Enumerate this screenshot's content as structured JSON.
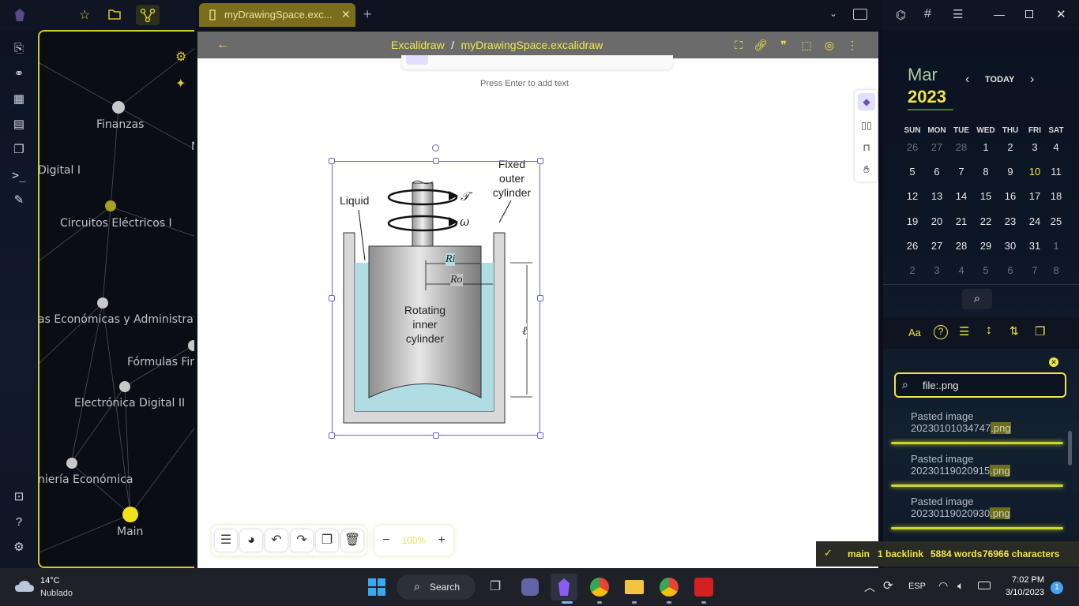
{
  "window": {
    "tab_title": "myDrawingSpace.exc...",
    "add_tab": "+"
  },
  "doc_header": {
    "back": "←",
    "breadcrumb_root": "Excalidraw",
    "separator": "/",
    "file_name": "myDrawingSpace.excalidraw"
  },
  "graph": {
    "nodes": [
      {
        "label": "Finanzas"
      },
      {
        "label": "Digital I"
      },
      {
        "label": "Circuitos Eléctricos I"
      },
      {
        "label": "as Económicas y Administrativa"
      },
      {
        "label": "Fórmulas Fina"
      },
      {
        "label": "Electrónica Digital II"
      },
      {
        "label": "niería Económica"
      },
      {
        "label": "Main"
      },
      {
        "label": "N"
      }
    ]
  },
  "canvas": {
    "hint": "Press Enter to add text",
    "figure": {
      "liquid": "Liquid",
      "fixed_outer": [
        "Fixed",
        "outer",
        "cylinder"
      ],
      "torque": "𝒯",
      "omega": "ω",
      "ri": "Ri",
      "ro": "Ro",
      "ell": "ℓ",
      "rotating": [
        "Rotating",
        "inner",
        "cylinder"
      ]
    },
    "zoom": "100%",
    "zoom_minus": "−",
    "zoom_plus": "+"
  },
  "calendar": {
    "month": "Mar",
    "year": "2023",
    "today": "TODAY",
    "weekdays": [
      "SUN",
      "MON",
      "TUE",
      "WED",
      "THU",
      "FRI",
      "SAT"
    ],
    "weeks": [
      [
        "26",
        "27",
        "28",
        "1",
        "2",
        "3",
        "4"
      ],
      [
        "5",
        "6",
        "7",
        "8",
        "9",
        "10",
        "11"
      ],
      [
        "12",
        "13",
        "14",
        "15",
        "16",
        "17",
        "18"
      ],
      [
        "19",
        "20",
        "21",
        "22",
        "23",
        "24",
        "25"
      ],
      [
        "26",
        "27",
        "28",
        "29",
        "30",
        "31",
        "1"
      ],
      [
        "2",
        "3",
        "4",
        "5",
        "6",
        "7",
        "8"
      ]
    ],
    "today_date": "10",
    "accent": "#f0e54a"
  },
  "search": {
    "query": "file:.png",
    "results": [
      {
        "line1": "Pasted image",
        "line2_base": "20230101034747",
        "line2_hl": ".png"
      },
      {
        "line1": "Pasted image",
        "line2_base": "20230119020915",
        "line2_hl": ".png"
      },
      {
        "line1": "Pasted image",
        "line2_base": "20230119020930",
        "line2_hl": ".png"
      }
    ]
  },
  "status_bar": {
    "branch": "main",
    "backlinks": "1 backlink",
    "words": "5884 words",
    "chars": "76966 characters"
  },
  "taskbar": {
    "weather_temp": "14°C",
    "weather_desc": "Nublado",
    "search_label": "Search",
    "lang": "ESP",
    "time": "7:02 PM",
    "date": "3/10/2023",
    "notif_count": "1"
  }
}
